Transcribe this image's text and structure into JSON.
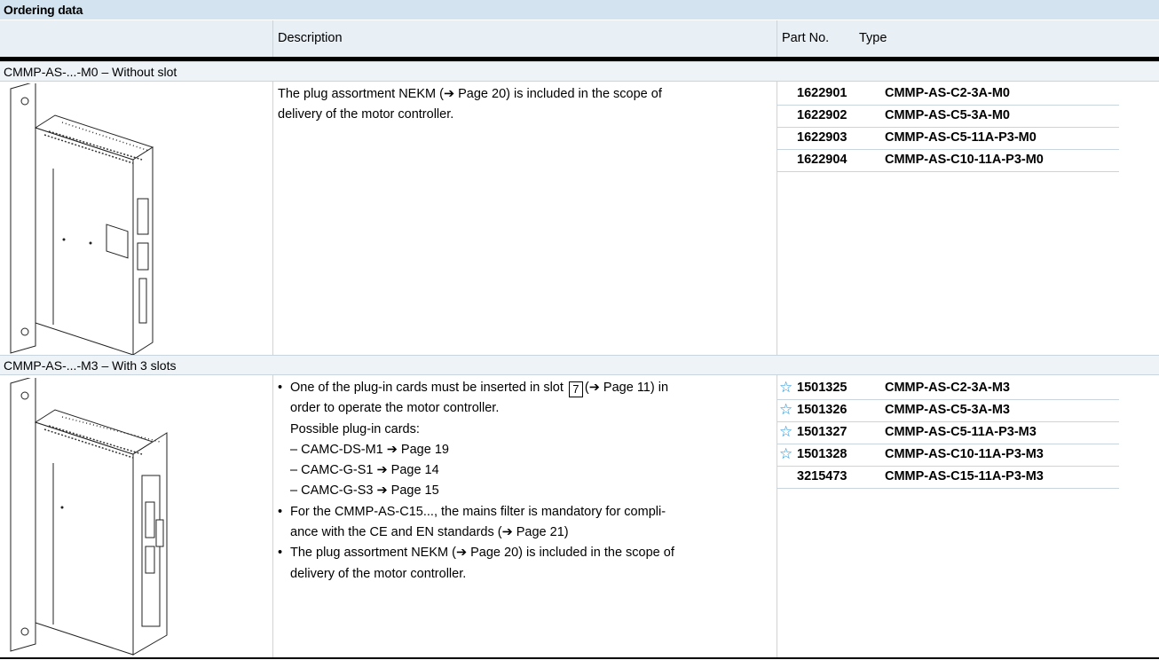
{
  "title": "Ordering data",
  "headers": {
    "description": "Description",
    "part_no": "Part No.",
    "type": "Type"
  },
  "sections": [
    {
      "label": "CMMP-AS-...-M0 – Without slot",
      "desc_line1": "The plug assortment NEKM (➔ Page 20) is included in the scope of",
      "desc_line2": "delivery of the motor controller.",
      "rows": [
        {
          "part": "1622901",
          "type": "CMMP-AS-C2-3A-M0",
          "star": false
        },
        {
          "part": "1622902",
          "type": "CMMP-AS-C5-3A-M0",
          "star": false
        },
        {
          "part": "1622903",
          "type": "CMMP-AS-C5-11A-P3-M0",
          "star": false
        },
        {
          "part": "1622904",
          "type": "CMMP-AS-C10-11A-P3-M0",
          "star": false
        }
      ]
    },
    {
      "label": "CMMP-AS-...-M3 – With 3 slots",
      "b1_pre": "One of the plug-in cards must be inserted in slot",
      "b1_slot": "7",
      "b1_post": "(➔ Page 11) in",
      "b1_line2": "order to operate the motor controller.",
      "b1_line3": "Possible plug-in cards:",
      "cards": [
        "– CAMC-DS-M1 ➔ Page 19",
        "– CAMC-G-S1 ➔ Page 14",
        "– CAMC-G-S3 ➔ Page 15"
      ],
      "b2_line1": "For the CMMP-AS-C15..., the mains filter is mandatory for compli-",
      "b2_line2": "ance with the CE and EN standards (➔ Page 21)",
      "b3_line1": "The plug assortment NEKM (➔ Page 20) is included in the scope of",
      "b3_line2": "delivery of the motor controller.",
      "bullet": "•",
      "star_glyph": "☆",
      "rows": [
        {
          "part": "1501325",
          "type": "CMMP-AS-C2-3A-M3",
          "star": true
        },
        {
          "part": "1501326",
          "type": "CMMP-AS-C5-3A-M3",
          "star": true
        },
        {
          "part": "1501327",
          "type": "CMMP-AS-C5-11A-P3-M3",
          "star": true
        },
        {
          "part": "1501328",
          "type": "CMMP-AS-C10-11A-P3-M3",
          "star": true
        },
        {
          "part": "3215473",
          "type": "CMMP-AS-C15-11A-P3-M3",
          "star": false
        }
      ]
    }
  ],
  "colors": {
    "title_bg": "#d3e3ef",
    "header_bg": "#e8f0f6",
    "star": "#1f8ed6",
    "grid": "#c9d5de"
  }
}
